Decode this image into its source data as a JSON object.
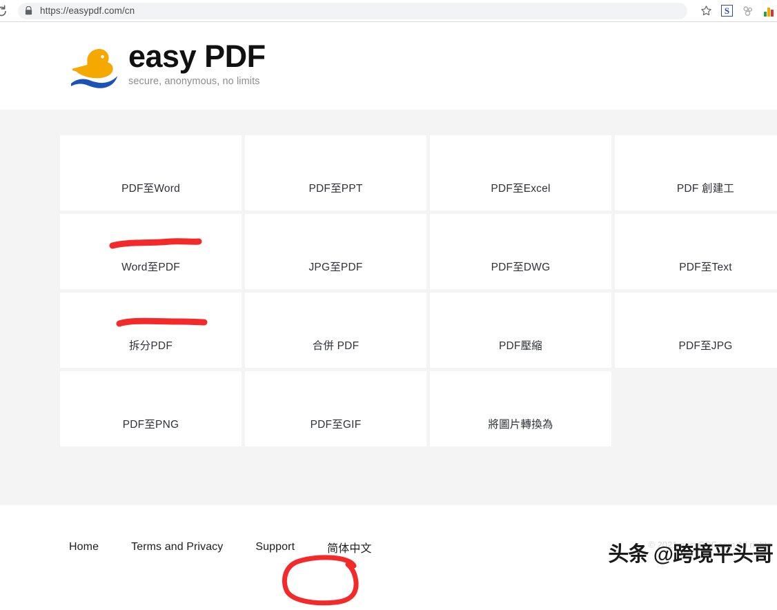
{
  "browser": {
    "url": "https://easypdf.com/cn",
    "reload_icon": "reload-icon",
    "lock_icon": "lock-icon",
    "star_icon": "bookmark-star-icon",
    "extension_s_label": "S",
    "puzzle_icon": "extensions-puzzle-icon",
    "chart_extension_icon": "chart-extension-icon"
  },
  "header": {
    "brand_name": "easy PDF",
    "tagline": "secure, anonymous, no limits",
    "logo_icon": "duck-logo-icon"
  },
  "tools": [
    {
      "label": "PDF至Word",
      "annotated": true
    },
    {
      "label": "PDF至PPT",
      "annotated": false
    },
    {
      "label": "PDF至Excel",
      "annotated": false
    },
    {
      "label": "PDF 創建工",
      "annotated": false
    },
    {
      "label": "Word至PDF",
      "annotated": true
    },
    {
      "label": "JPG至PDF",
      "annotated": false
    },
    {
      "label": "PDF至DWG",
      "annotated": false
    },
    {
      "label": "PDF至Text",
      "annotated": false
    },
    {
      "label": "拆分PDF",
      "annotated": false
    },
    {
      "label": "合併 PDF",
      "annotated": false
    },
    {
      "label": "PDF壓縮",
      "annotated": false
    },
    {
      "label": "PDF至JPG",
      "annotated": false
    },
    {
      "label": "PDF至PNG",
      "annotated": false
    },
    {
      "label": "PDF至GIF",
      "annotated": false
    },
    {
      "label": "將圖片轉換為",
      "annotated": false
    }
  ],
  "footer": {
    "links": [
      {
        "label": "Home"
      },
      {
        "label": "Terms and Privacy"
      },
      {
        "label": "Support"
      },
      {
        "label": "简体中文"
      }
    ],
    "copyright": "© 2021 easyPDF.com All rights",
    "watermark": "头条 @跨境平头哥"
  },
  "annotations": {
    "underline_color": "#f42a2a",
    "circle_color": "#f42a2a"
  },
  "colors": {
    "page_background": "#f4f4f4",
    "tile_background": "#ffffff",
    "brand_text": "#111111",
    "duck_body": "#f5a800",
    "duck_wave": "#1a52b5"
  }
}
